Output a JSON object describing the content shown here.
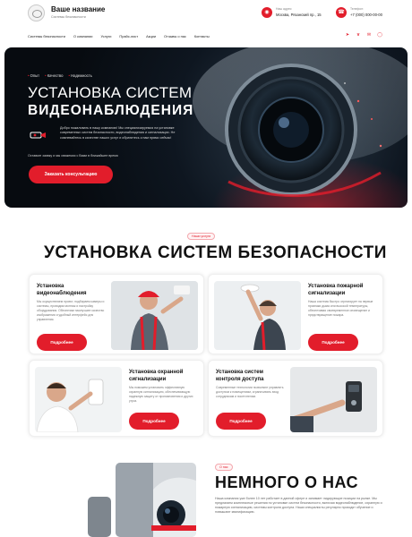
{
  "header": {
    "brand_title": "Ваше название",
    "brand_subtitle": "Системы безопасности",
    "address_label": "Наш адрес:",
    "address_value": "Москва, Рязанский пр., 15",
    "phone_label": "Телефон:",
    "phone_value": "+7 (000) 000-00-00"
  },
  "nav": {
    "items": [
      "Системы безопасности",
      "О компании",
      "Услуги",
      "Прайс-лист",
      "Акции",
      "Отзывы о нас",
      "Контакты"
    ],
    "socials": [
      "telegram-icon",
      "vk-icon",
      "email-icon",
      "whatsapp-icon"
    ]
  },
  "hero": {
    "tags": [
      "Опыт",
      "Качество",
      "Надежность"
    ],
    "title_line1": "УСТАНОВКА СИСТЕМ",
    "title_line2": "ВИДЕОНАБЛЮДЕНИЯ",
    "description": "Добро пожаловать в нашу компанию! Мы специализируемся на установке современных систем безопасности, видеонаблюдения и сигнализации. Не сомневайтесь в качестве наших услуг и обратитесь к нам прямо сейчас!",
    "note": "Оставьте заявку и мы свяжемся с Вами в ближайшее время",
    "cta_label": "Заказать консультацию"
  },
  "section_services": {
    "pill": "Наши услуги",
    "title": "УСТАНОВКА СИСТЕМ БЕЗОПАСНОСТИ",
    "cards": [
      {
        "title_line1": "Установка",
        "title_line2": "видеонаблюдения",
        "description": "Мы осуществляем проект, подбираем камеры и системы, проводим монтаж и настройку оборудования. Обеспечим наилучшее качество изображения и удобный интерфейс для управления.",
        "button": "Подробнее"
      },
      {
        "title_line1": "Установка пожарной",
        "title_line2": "сигнализации",
        "description": "Наша система быстро отреагирует на первые признаки дыма или высокой температуры, обеспечивая своевременное оповещение и предотвращение пожара.",
        "button": "Подробнее"
      },
      {
        "title_line1": "Установка охранной",
        "title_line2": "сигнализации",
        "description": "Мы поможем установить эффективную охранную сигнализацию, обеспечивающую надежную защиту от проникновения и других угроз.",
        "button": "Подробнее"
      },
      {
        "title_line1": "Установка систем",
        "title_line2": "контроля доступа",
        "description": "Современные технологии позволяют управлять доступом к помещениям, ограничивать вход сотрудникам и посетителям.",
        "button": "Подробнее"
      }
    ]
  },
  "section_about": {
    "pill": "О нас",
    "title": "НЕМНОГО О НАС",
    "text": "Наша компания уже более 10 лет работает в данной сфере и занимает лидирующие позиции на рынке. Мы предлагаем комплексные решения по установке систем безопасности, включая видеонаблюдение, охранную и пожарную сигнализацию, системы контроля доступа. Наши специалисты регулярно проходят обучение и повышают квалификацию."
  },
  "colors": {
    "accent": "#e21d2b",
    "hero_bg": "#0e1620",
    "text": "#1a1a1a"
  }
}
